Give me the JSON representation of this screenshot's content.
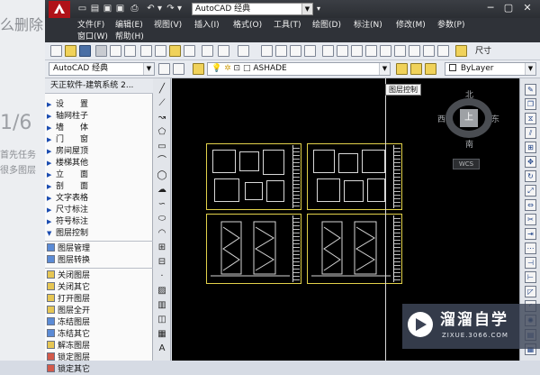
{
  "background_page": {
    "lines": [
      "么删除",
      "1/6",
      "首先任务",
      "很多图层"
    ]
  },
  "titlebar": {
    "workspace_value": "AutoCAD 经典"
  },
  "menubar": {
    "items": [
      "文件(F)",
      "编辑(E)",
      "视图(V)",
      "插入(I)",
      "格式(O)",
      "工具(T)",
      "绘图(D)",
      "标注(N)",
      "修改(M)",
      "参数(P)",
      "窗口(W)",
      "帮助(H)"
    ]
  },
  "toolbar2": {
    "workspace_value": "AutoCAD 经典",
    "layer_value": "ASHADE",
    "color_value": "ByLayer",
    "dim_style_label": "尺寸"
  },
  "tz_panel": {
    "header": "天正软件-建筑系统 2...",
    "menu_items": [
      "设　　置",
      "轴网柱子",
      "墙　　体",
      "门　　窗",
      "房间屋顶",
      "楼梯其他",
      "立　　面",
      "剖　　面",
      "文字表格",
      "尺寸标注",
      "符号标注",
      "图层控制"
    ],
    "sub_items_1": [
      "图层管理",
      "图层转换"
    ],
    "sub_items_2": [
      "关闭图层",
      "关闭其它",
      "打开图层",
      "图层全开",
      "冻结图层",
      "冻结其它",
      "解冻图层",
      "锁定图层",
      "锁定其它"
    ]
  },
  "canvas": {
    "tooltip": "图层控制",
    "compass": {
      "north": "北",
      "south": "南",
      "east": "东",
      "west": "西",
      "top": "上"
    },
    "wcs_label": "WCS"
  },
  "watermark": {
    "title": "溜溜自学",
    "subtitle": "ZIXUE.3066.COM"
  },
  "colors": {
    "titlebar": "#2f3238",
    "canvas": "#000000",
    "sheet_border": "#e2d14a",
    "autocad_red": "#b01218"
  }
}
